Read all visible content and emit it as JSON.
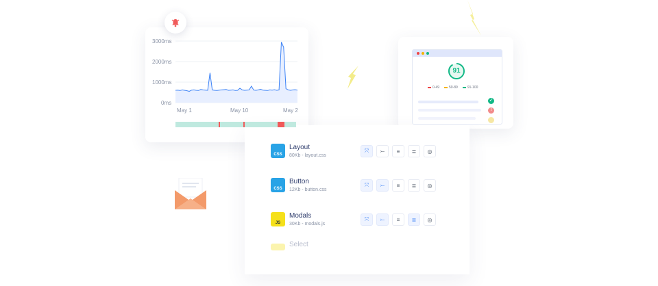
{
  "chart": {
    "y_ticks": [
      "3000ms",
      "2000ms",
      "1000ms",
      "0ms"
    ],
    "x_ticks": [
      "May 1",
      "May 10",
      "May 2"
    ],
    "line_color": "#3b82f6",
    "fill_color": "#e8efff",
    "status_bar": {
      "ok_color": "#bfe9df",
      "alert_color": "#f05a5a"
    }
  },
  "chart_data": {
    "type": "line",
    "title": "",
    "xlabel": "",
    "ylabel": "",
    "ylim": [
      0,
      3000
    ],
    "x_tick_labels": [
      "May 1",
      "May 10",
      "May 2"
    ],
    "values": [
      600,
      610,
      590,
      620,
      600,
      580,
      550,
      610,
      620,
      600,
      590,
      640,
      620,
      610,
      600,
      1450,
      620,
      600,
      590,
      610,
      620,
      630,
      640,
      600,
      610,
      620,
      590,
      600,
      700,
      620,
      600,
      610,
      620,
      800,
      610,
      600,
      620,
      650,
      610,
      600,
      590,
      620,
      610,
      630,
      600,
      620,
      2950,
      2700,
      680,
      620,
      600,
      620,
      630,
      610
    ]
  },
  "score": {
    "value": "91",
    "ring_color": "#12b886",
    "fraction": 0.91,
    "legend": [
      {
        "label": "0-49",
        "color": "#ef4444"
      },
      {
        "label": "50-89",
        "color": "#f5b400"
      },
      {
        "label": "91-100",
        "color": "#12b886"
      }
    ],
    "audits": [
      {
        "icon": "check-icon",
        "glyph": "✓",
        "color": "#12b886"
      },
      {
        "icon": "warning-icon",
        "glyph": "!",
        "color": "#f28b8b"
      },
      {
        "icon": "info-icon",
        "glyph": "",
        "color": "#f6e7a4"
      }
    ]
  },
  "files": [
    {
      "badge": "CSS",
      "badge_color": "#29a3e6",
      "name": "Layout",
      "meta": "80Kb - layout.css",
      "active": [
        0,
        1
      ]
    },
    {
      "badge": "CSS",
      "badge_color": "#29a3e6",
      "name": "Button",
      "meta": "12Kb - button.css",
      "active": [
        0,
        1
      ]
    },
    {
      "badge": "JS",
      "badge_color": "#f5e01a",
      "name": "Modals",
      "meta": "30Kb - modals.js",
      "active": [
        0,
        1,
        3
      ]
    },
    {
      "badge": "",
      "badge_color": "#f5e01a",
      "name": "Select",
      "meta": "",
      "active": []
    }
  ],
  "action_icons": [
    "compress-icon",
    "merge-icon",
    "align-icon",
    "list-icon",
    "eye-off-icon"
  ],
  "colors": {
    "accent": "#3b82f6",
    "envelope": "#f39a6a",
    "bolt": "#f3ec8a"
  }
}
